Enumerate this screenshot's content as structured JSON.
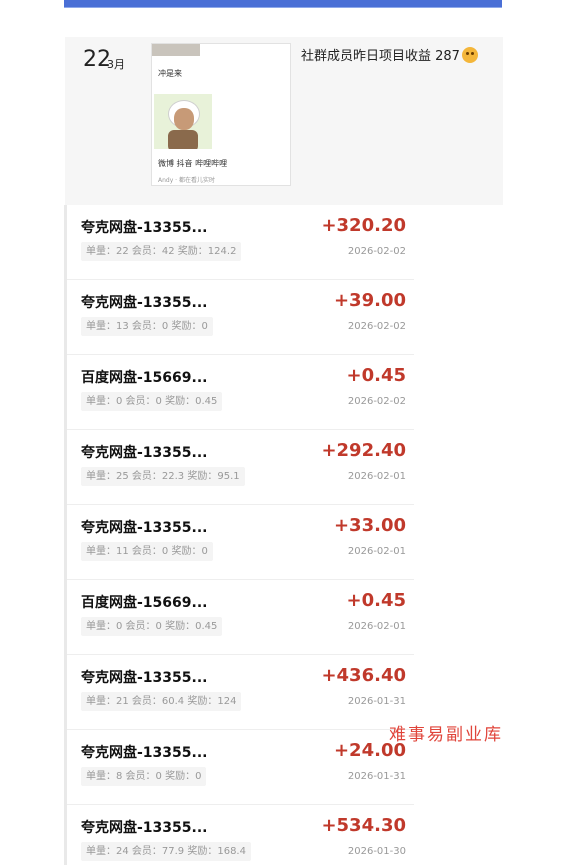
{
  "post": {
    "day": "22",
    "month": "3月",
    "text": "社群成员昨日项目收益 287",
    "emoji_icon": "smiling-face-icon",
    "thumbnail": {
      "caption_top": "冲是来",
      "caption_bottom": "微博 抖音 哔哩哔哩",
      "footer": "Andy · 都在看儿实时"
    }
  },
  "records": [
    {
      "title": "夸克网盘-13355...",
      "meta": "单量：22 会员：42 奖励：124.2",
      "amount": "+320.20",
      "date": "2026-02-02"
    },
    {
      "title": "夸克网盘-13355...",
      "meta": "单量：13 会员：0 奖励：0",
      "amount": "+39.00",
      "date": "2026-02-02"
    },
    {
      "title": "百度网盘-15669...",
      "meta": "单量：0 会员：0 奖励：0.45",
      "amount": "+0.45",
      "date": "2026-02-02"
    },
    {
      "title": "夸克网盘-13355...",
      "meta": "单量：25 会员：22.3 奖励：95.1",
      "amount": "+292.40",
      "date": "2026-02-01"
    },
    {
      "title": "夸克网盘-13355...",
      "meta": "单量：11 会员：0 奖励：0",
      "amount": "+33.00",
      "date": "2026-02-01"
    },
    {
      "title": "百度网盘-15669...",
      "meta": "单量：0 会员：0 奖励：0.45",
      "amount": "+0.45",
      "date": "2026-02-01"
    },
    {
      "title": "夸克网盘-13355...",
      "meta": "单量：21 会员：60.4 奖励：124",
      "amount": "+436.40",
      "date": "2026-01-31"
    },
    {
      "title": "夸克网盘-13355...",
      "meta": "单量：8 会员：0 奖励：0",
      "amount": "+24.00",
      "date": "2026-01-31"
    },
    {
      "title": "夸克网盘-13355...",
      "meta": "单量：24 会员：77.9 奖励：168.4",
      "amount": "+534.30",
      "date": "2026-01-30"
    }
  ],
  "watermark": "难事易副业库",
  "colors": {
    "amount": "#c0392b",
    "accent_bar": "#4a6fd6",
    "watermark": "#e0443a"
  }
}
